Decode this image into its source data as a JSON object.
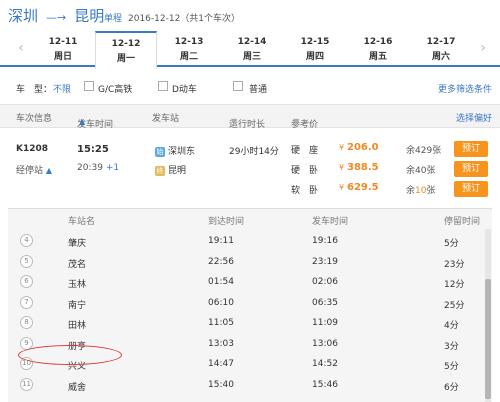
{
  "header": {
    "from": "深圳",
    "to": "昆明",
    "badge": "单程",
    "date_info": "2016-12-12（共1个车次）"
  },
  "date_tabs": [
    {
      "date": "12-11",
      "weekday": "周日"
    },
    {
      "date": "12-12",
      "weekday": "周一"
    },
    {
      "date": "12-13",
      "weekday": "周二"
    },
    {
      "date": "12-14",
      "weekday": "周三"
    },
    {
      "date": "12-15",
      "weekday": "周四"
    },
    {
      "date": "12-16",
      "weekday": "周五"
    },
    {
      "date": "12-17",
      "weekday": "周六"
    }
  ],
  "active_date_index": 1,
  "filter": {
    "label": "车　型：",
    "no_limit": "不限",
    "options": [
      "G/C高铁",
      "D动车",
      "普通"
    ],
    "more": "更多筛选条件"
  },
  "columns": {
    "train": "车次信息",
    "depart": "发车时间",
    "station": "发车站",
    "duration": "运行时长",
    "price": "参考价",
    "preference": "选择偏好"
  },
  "train": {
    "number": "K1208",
    "via_label": "经停站",
    "depart_time": "15:25",
    "arrive_time": "20:39",
    "arrive_plus": "+1",
    "from_station": "深圳东",
    "to_station": "昆明",
    "start_icon": "始",
    "end_icon": "终",
    "duration": "29小时14分",
    "seats": [
      {
        "name": "硬　座",
        "price": "206.0",
        "left_prefix": "余",
        "left_num": "429",
        "left_suffix": "张",
        "book": "预订"
      },
      {
        "name": "硬　卧",
        "price": "388.5",
        "left_prefix": "余",
        "left_num": "40",
        "left_suffix": "张",
        "book": "预订"
      },
      {
        "name": "软　卧",
        "price": "629.5",
        "left_prefix": "余",
        "left_num": "10",
        "left_suffix": "张",
        "book": "预订"
      }
    ],
    "yen": "¥"
  },
  "stops_header": {
    "station": "车站名",
    "arrive": "到达时间",
    "depart": "发车时间",
    "stay": "停留时间"
  },
  "stops": [
    {
      "idx": "4",
      "name": "肇庆",
      "arrive": "19:11",
      "depart": "19:16",
      "stay": "5分"
    },
    {
      "idx": "5",
      "name": "茂名",
      "arrive": "22:56",
      "depart": "23:19",
      "stay": "23分"
    },
    {
      "idx": "6",
      "name": "玉林",
      "arrive": "01:54",
      "depart": "02:06",
      "stay": "12分"
    },
    {
      "idx": "7",
      "name": "南宁",
      "arrive": "06:10",
      "depart": "06:35",
      "stay": "25分"
    },
    {
      "idx": "8",
      "name": "田林",
      "arrive": "11:05",
      "depart": "11:09",
      "stay": "4分"
    },
    {
      "idx": "9",
      "name": "册亨",
      "arrive": "13:03",
      "depart": "13:06",
      "stay": "3分"
    },
    {
      "idx": "10",
      "name": "兴义",
      "arrive": "14:47",
      "depart": "14:52",
      "stay": "5分"
    },
    {
      "idx": "11",
      "name": "威舍",
      "arrive": "15:40",
      "depart": "15:46",
      "stay": "6分"
    }
  ],
  "colors": {
    "accent": "#3a78c8",
    "orange": "#f7941d",
    "annotation": "#dd3333"
  }
}
